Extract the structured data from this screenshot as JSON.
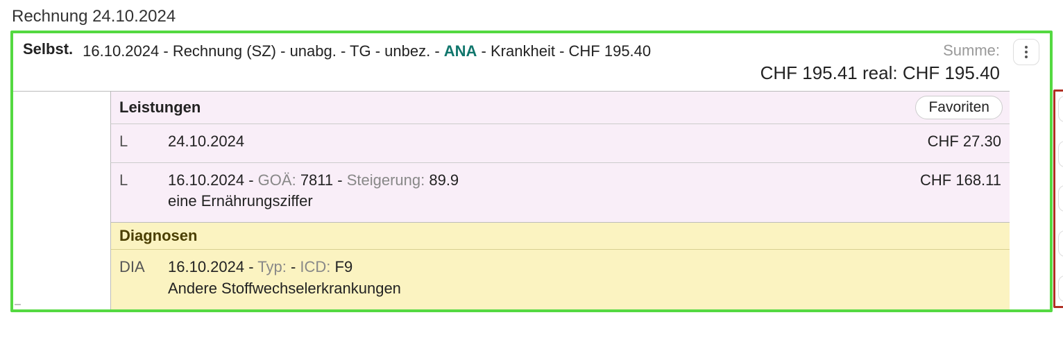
{
  "page_title": "Rechnung 24.10.2024",
  "header": {
    "label": "Selbst.",
    "crumb_date": "16.10.2024",
    "crumb_rechnung": "Rechnung (SZ)",
    "crumb_unabg": "unabg.",
    "crumb_tg": "TG",
    "crumb_unbez": "unbez.",
    "crumb_ana": "ANA",
    "crumb_krankheit": "Krankheit",
    "crumb_amount": "CHF 195.40",
    "summe_label": "Summe:",
    "summe_amount": "CHF 195.41",
    "summe_real_label": "real:",
    "summe_real_amount": "CHF 195.40"
  },
  "sections": {
    "leistungen": {
      "title": "Leistungen",
      "favoriten": "Favoriten"
    },
    "diagnosen": {
      "title": "Diagnosen"
    }
  },
  "rows": {
    "l1": {
      "tag": "L",
      "date": "24.10.2024",
      "amount": "CHF 27.30"
    },
    "l2": {
      "tag": "L",
      "date": "16.10.2024",
      "goae_label": "GOÄ:",
      "goae_val": "7811",
      "steig_label": "Steigerung:",
      "steig_val": "89.9",
      "desc2": "eine Ernährungsziffer",
      "amount": "CHF 168.11"
    },
    "d1": {
      "tag": "DIA",
      "date": "16.10.2024",
      "typ_label": "Typ:",
      "typ_val": "",
      "icd_label": "ICD:",
      "icd_val": "F9",
      "desc2": "Andere Stoffwechselerkrankungen"
    }
  },
  "sep": " - "
}
